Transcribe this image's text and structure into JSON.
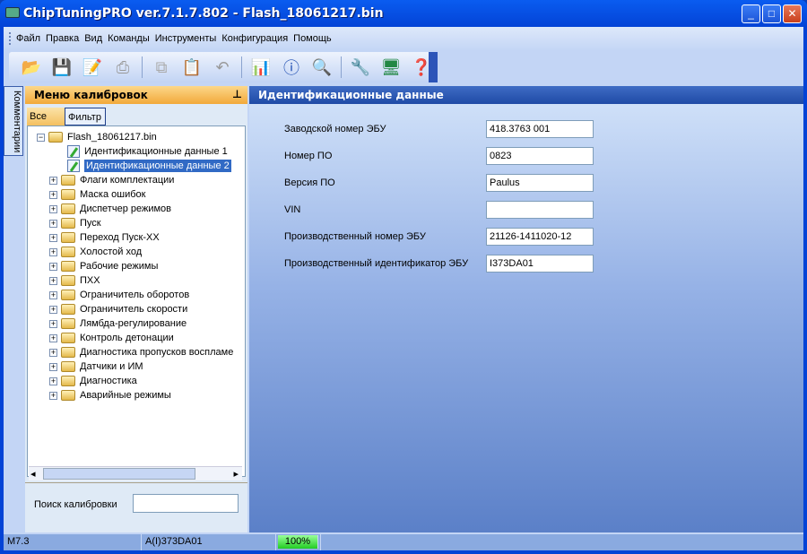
{
  "window": {
    "title": "ChipTuningPRO ver.7.1.7.802 - Flash_18061217.bin"
  },
  "menu": [
    "Файл",
    "Правка",
    "Вид",
    "Команды",
    "Инструменты",
    "Конфигурация",
    "Помощь"
  ],
  "toolbar": [
    "open-icon",
    "save-icon",
    "save-edit-icon",
    "print-icon",
    "copy-icon",
    "paste-icon",
    "undo-icon",
    "chart-icon",
    "info-icon",
    "search-hex-icon",
    "tools-icon",
    "network-icon",
    "help-icon"
  ],
  "side_tab": "Комментарии",
  "left": {
    "title": "Меню калибровок",
    "tabs": [
      "Все",
      "Фильтр"
    ],
    "search_label": "Поиск калибровки",
    "search_value": ""
  },
  "tree": {
    "root": "Flash_18061217.bin",
    "docs": [
      "Идентификационные данные 1",
      "Идентификационные данные 2"
    ],
    "folders": [
      "Флаги комплектации",
      "Маска ошибок",
      "Диспетчер режимов",
      "Пуск",
      "Переход Пуск-ХХ",
      "Холостой ход",
      "Рабочие режимы",
      "ПХХ",
      "Ограничитель оборотов",
      "Ограничитель скорости",
      "Лямбда-регулирование",
      "Контроль детонации",
      "Диагностика пропусков воспламе",
      "Датчики и ИМ",
      "Диагностика",
      "Аварийные режимы"
    ]
  },
  "right": {
    "title": "Идентификационные данные",
    "fields": [
      {
        "label": "Заводской номер ЭБУ",
        "value": "418.3763 001"
      },
      {
        "label": "Номер ПО",
        "value": "0823"
      },
      {
        "label": "Версия ПО",
        "value": "Paulus"
      },
      {
        "label": "VIN",
        "value": ""
      },
      {
        "label": "Производственный номер ЭБУ",
        "value": "21126-1411020-12"
      },
      {
        "label": "Производственный идентификатор ЭБУ",
        "value": "I373DA01"
      }
    ]
  },
  "status": {
    "ecu": "M7.3",
    "id": "A(I)373DA01",
    "progress": "100%"
  }
}
